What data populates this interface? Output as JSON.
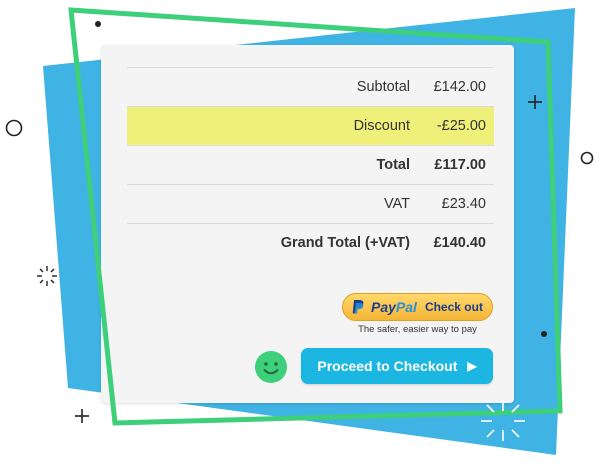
{
  "summary": {
    "rows": [
      {
        "label": "Subtotal",
        "value": "£142.00"
      },
      {
        "label": "Discount",
        "value": "-£25.00"
      },
      {
        "label": "Total",
        "value": "£117.00"
      },
      {
        "label": "VAT",
        "value": "£23.40"
      },
      {
        "label": "Grand Total (+VAT)",
        "value": "£140.40"
      }
    ]
  },
  "paypal": {
    "brand_first": "Pay",
    "brand_second": "Pal",
    "button_text": "Check out",
    "tagline": "The safer, easier way to pay"
  },
  "checkout": {
    "label": "Proceed to Checkout",
    "arrow": "▶"
  },
  "colors": {
    "accent_blue": "#1cb6e2",
    "frame_green": "#3dcf7a",
    "backdrop_blue": "#3fb3e3",
    "highlight_yellow": "#eef07a",
    "paypal_gold": "#f5b536"
  },
  "icons": {
    "smiley": "smiley-icon",
    "paypal": "paypal-icon",
    "arrow": "play-arrow-icon"
  }
}
